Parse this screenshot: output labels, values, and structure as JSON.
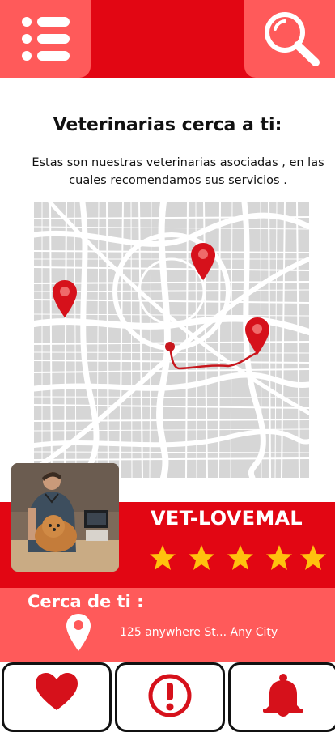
{
  "header": {
    "menu_icon": "list-icon",
    "search_icon": "search-icon",
    "colors": {
      "bar": "#e20613",
      "button": "#ff5a5a"
    }
  },
  "main": {
    "title": "Veterinarias cerca a ti:",
    "subtitle": "Estas son nuestras veterinarias  asociadas , en las cuales recomendamos sus servicios ."
  },
  "map": {
    "pins": 3,
    "route": true
  },
  "vet_card": {
    "name": "VET-LOVEMAL",
    "rating": 5,
    "rating_max": 5,
    "photo": "veterinarian-with-dog-photo"
  },
  "nearby": {
    "title": "Cerca de ti :",
    "address": "125 anywhere St... Any City",
    "icon": "location-pin-icon"
  },
  "bottom_nav": [
    {
      "name": "favorites-tab",
      "icon": "heart-icon"
    },
    {
      "name": "alerts-tab",
      "icon": "exclamation-icon"
    },
    {
      "name": "notifications-tab",
      "icon": "bell-icon"
    }
  ]
}
